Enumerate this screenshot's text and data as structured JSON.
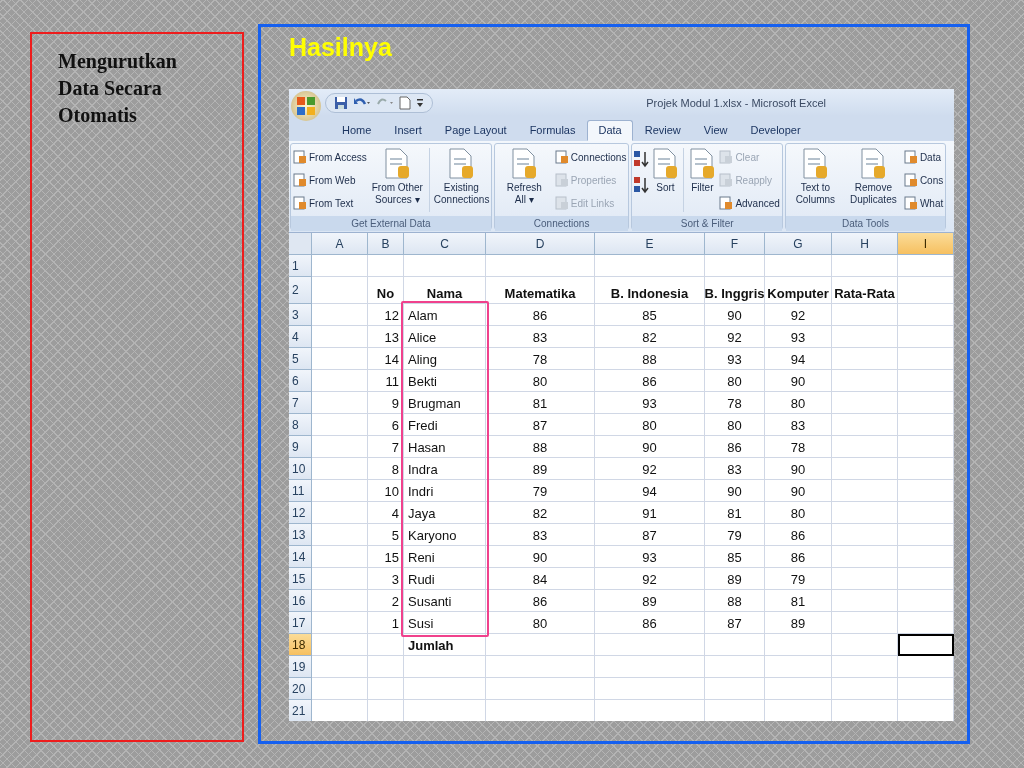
{
  "slide": {
    "side_note": "Mengurutkan Data Secara Otomatis",
    "heading": "Hasilnya"
  },
  "excel": {
    "title": "Projek Modul 1.xlsx - Microsoft Excel",
    "tabs": [
      {
        "label": "Home",
        "selected": false
      },
      {
        "label": "Insert",
        "selected": false
      },
      {
        "label": "Page Layout",
        "selected": false
      },
      {
        "label": "Formulas",
        "selected": false
      },
      {
        "label": "Data",
        "selected": true
      },
      {
        "label": "Review",
        "selected": false
      },
      {
        "label": "View",
        "selected": false
      },
      {
        "label": "Developer",
        "selected": false
      }
    ],
    "groups": [
      {
        "label": "Get External Data",
        "items": [
          {
            "kind": "stack",
            "buttons": [
              {
                "label": "From Access",
                "disabled": false
              },
              {
                "label": "From Web",
                "disabled": false
              },
              {
                "label": "From Text",
                "disabled": false
              }
            ]
          },
          {
            "kind": "large",
            "label": "From Other Sources",
            "caret": "▾"
          },
          {
            "kind": "separator"
          },
          {
            "kind": "large",
            "label": "Existing Connections"
          }
        ]
      },
      {
        "label": "Connections",
        "items": [
          {
            "kind": "large",
            "label": "Refresh All",
            "caret": "▾"
          },
          {
            "kind": "stack",
            "buttons": [
              {
                "label": "Connections",
                "disabled": false
              },
              {
                "label": "Properties",
                "disabled": true
              },
              {
                "label": "Edit Links",
                "disabled": true
              }
            ]
          }
        ]
      },
      {
        "label": "Sort & Filter",
        "items": [
          {
            "kind": "sort-icons"
          },
          {
            "kind": "large",
            "label": "Sort"
          },
          {
            "kind": "separator"
          },
          {
            "kind": "large",
            "label": "Filter"
          },
          {
            "kind": "stack",
            "buttons": [
              {
                "label": "Clear",
                "disabled": true
              },
              {
                "label": "Reapply",
                "disabled": true
              },
              {
                "label": "Advanced",
                "disabled": false
              }
            ]
          }
        ]
      },
      {
        "label": "Data Tools",
        "items": [
          {
            "kind": "large",
            "label": "Text to Columns"
          },
          {
            "kind": "large",
            "label": "Remove Duplicates"
          },
          {
            "kind": "stack",
            "buttons": [
              {
                "label": "Data",
                "disabled": false
              },
              {
                "label": "Cons",
                "disabled": false
              },
              {
                "label": "What",
                "disabled": false
              }
            ]
          }
        ]
      }
    ],
    "columns": [
      {
        "label": "A",
        "selected": false
      },
      {
        "label": "B",
        "selected": false
      },
      {
        "label": "C",
        "selected": false
      },
      {
        "label": "D",
        "selected": false
      },
      {
        "label": "E",
        "selected": false
      },
      {
        "label": "F",
        "selected": false
      },
      {
        "label": "G",
        "selected": false
      },
      {
        "label": "H",
        "selected": false
      },
      {
        "label": "I",
        "selected": true
      }
    ],
    "rows": [
      {
        "label": "1",
        "selected": false,
        "kind": "data",
        "cells": []
      },
      {
        "label": "2",
        "selected": false,
        "kind": "header",
        "cells": [
          null,
          "No",
          "Nama",
          "Matematika",
          "B. Indonesia",
          "B. Inggris",
          "Komputer",
          "Rata-Rata"
        ]
      },
      {
        "label": "3",
        "selected": false,
        "kind": "data",
        "cells": [
          null,
          "12",
          "Alam",
          "86",
          "85",
          "90",
          "92"
        ]
      },
      {
        "label": "4",
        "selected": false,
        "kind": "data",
        "cells": [
          null,
          "13",
          "Alice",
          "83",
          "82",
          "92",
          "93"
        ]
      },
      {
        "label": "5",
        "selected": false,
        "kind": "data",
        "cells": [
          null,
          "14",
          "Aling",
          "78",
          "88",
          "93",
          "94"
        ]
      },
      {
        "label": "6",
        "selected": false,
        "kind": "data",
        "cells": [
          null,
          "11",
          "Bekti",
          "80",
          "86",
          "80",
          "90"
        ]
      },
      {
        "label": "7",
        "selected": false,
        "kind": "data",
        "cells": [
          null,
          "9",
          "Brugman",
          "81",
          "93",
          "78",
          "80"
        ]
      },
      {
        "label": "8",
        "selected": false,
        "kind": "data",
        "cells": [
          null,
          "6",
          "Fredi",
          "87",
          "80",
          "80",
          "83"
        ]
      },
      {
        "label": "9",
        "selected": false,
        "kind": "data",
        "cells": [
          null,
          "7",
          "Hasan",
          "88",
          "90",
          "86",
          "78"
        ]
      },
      {
        "label": "10",
        "selected": false,
        "kind": "data",
        "cells": [
          null,
          "8",
          "Indra",
          "89",
          "92",
          "83",
          "90"
        ]
      },
      {
        "label": "11",
        "selected": false,
        "kind": "data",
        "cells": [
          null,
          "10",
          "Indri",
          "79",
          "94",
          "90",
          "90"
        ]
      },
      {
        "label": "12",
        "selected": false,
        "kind": "data",
        "cells": [
          null,
          "4",
          "Jaya",
          "82",
          "91",
          "81",
          "80"
        ]
      },
      {
        "label": "13",
        "selected": false,
        "kind": "data",
        "cells": [
          null,
          "5",
          "Karyono",
          "83",
          "87",
          "79",
          "86"
        ]
      },
      {
        "label": "14",
        "selected": false,
        "kind": "data",
        "cells": [
          null,
          "15",
          "Reni",
          "90",
          "93",
          "85",
          "86"
        ]
      },
      {
        "label": "15",
        "selected": false,
        "kind": "data",
        "cells": [
          null,
          "3",
          "Rudi",
          "84",
          "92",
          "89",
          "79"
        ]
      },
      {
        "label": "16",
        "selected": false,
        "kind": "data",
        "cells": [
          null,
          "2",
          "Susanti",
          "86",
          "89",
          "88",
          "81"
        ]
      },
      {
        "label": "17",
        "selected": false,
        "kind": "data",
        "cells": [
          null,
          "1",
          "Susi",
          "80",
          "86",
          "87",
          "89"
        ]
      },
      {
        "label": "18",
        "selected": true,
        "kind": "total",
        "cells": [
          null,
          null,
          "Jumlah"
        ]
      },
      {
        "label": "19",
        "selected": false,
        "kind": "data",
        "cells": []
      },
      {
        "label": "20",
        "selected": false,
        "kind": "data",
        "cells": []
      },
      {
        "label": "21",
        "selected": false,
        "kind": "data",
        "cells": []
      }
    ]
  }
}
